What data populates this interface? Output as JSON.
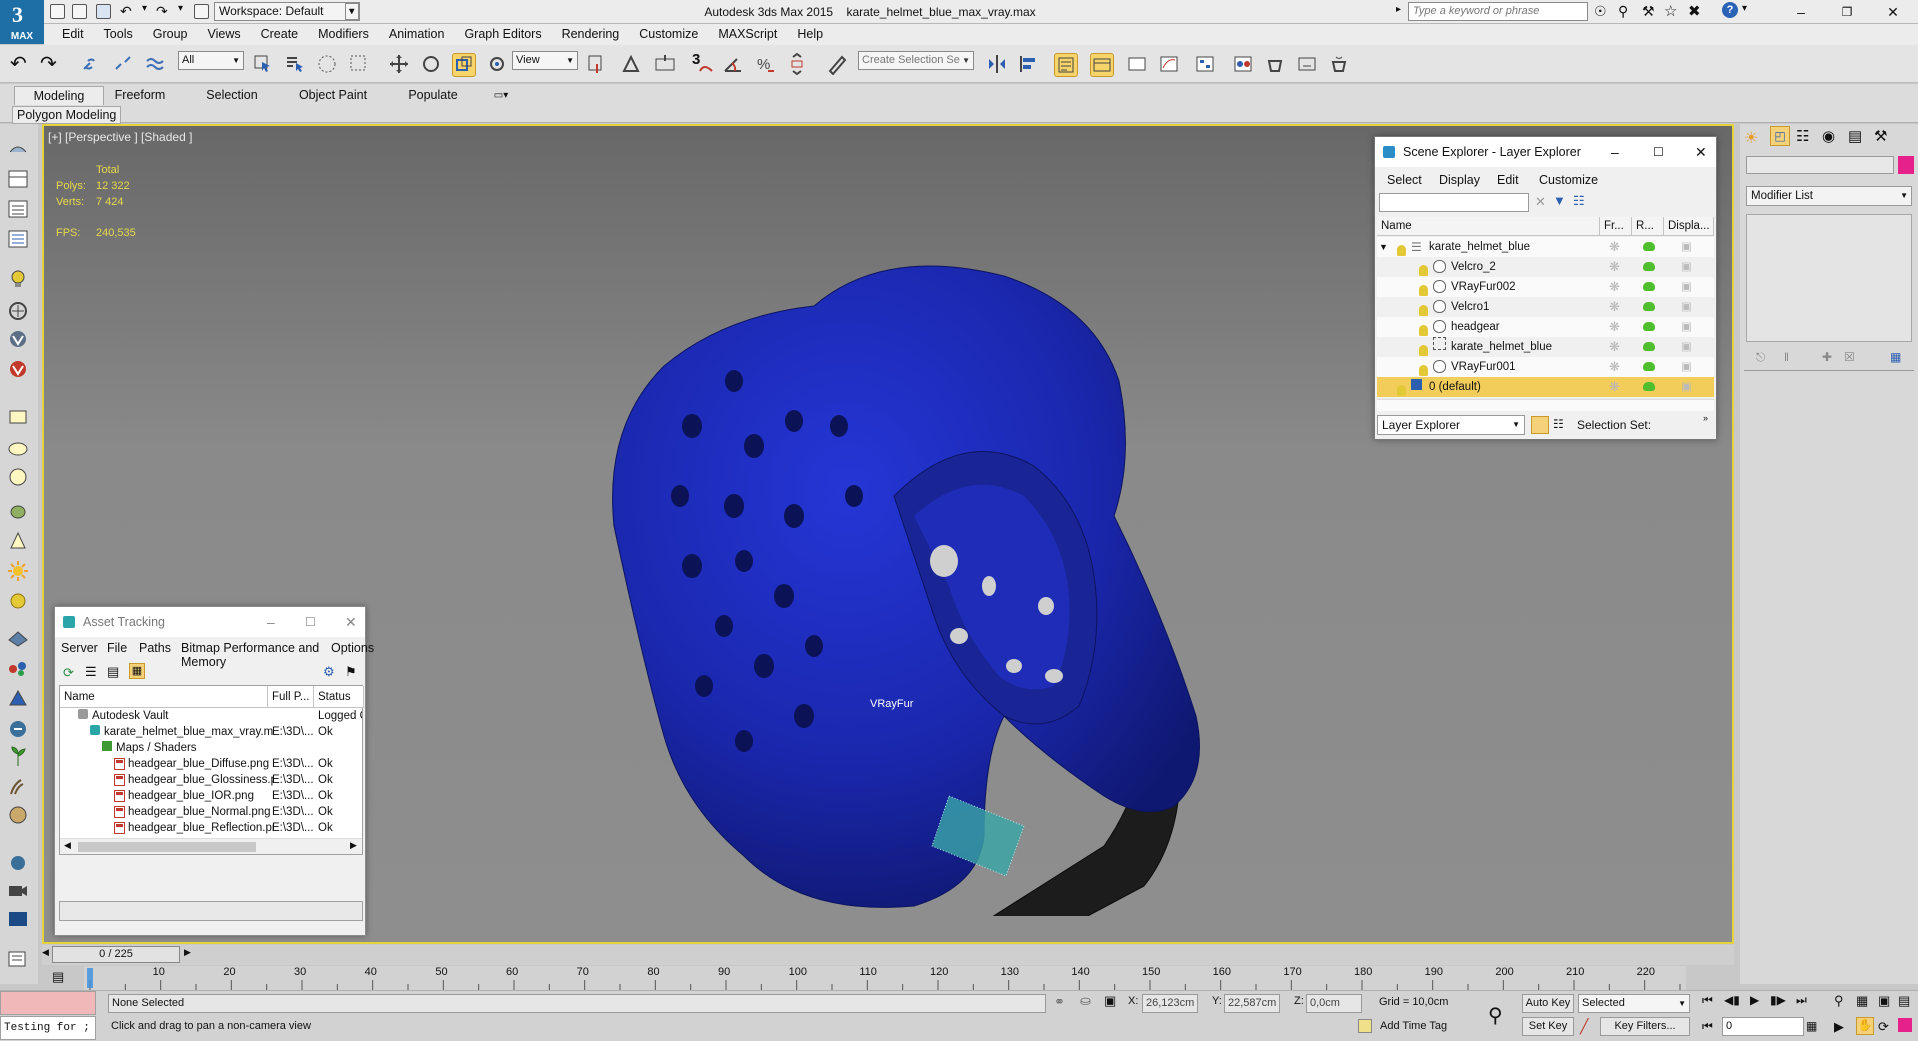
{
  "titlebar": {
    "workspace": "Workspace: Default",
    "app_name": "Autodesk 3ds Max  2015",
    "file_name": "karate_helmet_blue_max_vray.max",
    "search_placeholder": "Type a keyword or phrase",
    "logo_text": "MAX"
  },
  "menu": [
    "Edit",
    "Tools",
    "Group",
    "Views",
    "Create",
    "Modifiers",
    "Animation",
    "Graph Editors",
    "Rendering",
    "Customize",
    "MAXScript",
    "Help"
  ],
  "toolbar": {
    "selection_filter": "All",
    "ref_coord": "View",
    "create_selection_set": "Create Selection Se",
    "snap_angle_label": "3"
  },
  "ribbon": {
    "tabs": [
      "Modeling",
      "Freeform",
      "Selection",
      "Object Paint",
      "Populate"
    ],
    "sub_label": "Polygon Modeling"
  },
  "viewport": {
    "label": "[+] [Perspective ] [Shaded ]",
    "stats_header": "Total",
    "polys_label": "Polys:",
    "polys_value": "12 322",
    "verts_label": "Verts:",
    "verts_value": "7 424",
    "fps_label": "FPS:",
    "fps_value": "240,535",
    "object_tag": "VRayFur"
  },
  "scene_explorer": {
    "title": "Scene Explorer - Layer Explorer",
    "menu": [
      "Select",
      "Display",
      "Edit",
      "Customize"
    ],
    "columns": {
      "name": "Name",
      "frozen": "Fr...",
      "render": "R...",
      "display": "Displa..."
    },
    "rows": [
      {
        "name": "karate_helmet_blue",
        "kind": "layer",
        "level": 0
      },
      {
        "name": "Velcro_2",
        "kind": "object",
        "level": 1
      },
      {
        "name": "VRayFur002",
        "kind": "object",
        "level": 1
      },
      {
        "name": "Velcro1",
        "kind": "object",
        "level": 1
      },
      {
        "name": "headgear",
        "kind": "object",
        "level": 1
      },
      {
        "name": "karate_helmet_blue",
        "kind": "group",
        "level": 1
      },
      {
        "name": "VRayFur001",
        "kind": "object",
        "level": 1
      },
      {
        "name": "0 (default)",
        "kind": "layer-default",
        "level": 0
      }
    ],
    "footer_dropdown": "Layer Explorer",
    "selection_set_label": "Selection Set:"
  },
  "asset_tracking": {
    "title": "Asset Tracking",
    "menu": [
      "Server",
      "File",
      "Paths",
      "Bitmap Performance and Memory",
      "Options"
    ],
    "columns": {
      "name": "Name",
      "full_path": "Full P...",
      "status": "Status"
    },
    "rows": [
      {
        "name": "Autodesk Vault",
        "path": "",
        "status": "Logged Ou",
        "indent": 1,
        "icon": "vault"
      },
      {
        "name": "karate_helmet_blue_max_vray.max",
        "path": "E:\\3D\\...",
        "status": "Ok",
        "indent": 2,
        "icon": "max"
      },
      {
        "name": "Maps / Shaders",
        "path": "",
        "status": "",
        "indent": 3,
        "icon": "folder"
      },
      {
        "name": "headgear_blue_Diffuse.png",
        "path": "E:\\3D\\...",
        "status": "Ok",
        "indent": 4,
        "icon": "png"
      },
      {
        "name": "headgear_blue_Glossiness.png",
        "path": "E:\\3D\\...",
        "status": "Ok",
        "indent": 4,
        "icon": "png"
      },
      {
        "name": "headgear_blue_IOR.png",
        "path": "E:\\3D\\...",
        "status": "Ok",
        "indent": 4,
        "icon": "png"
      },
      {
        "name": "headgear_blue_Normal.png",
        "path": "E:\\3D\\...",
        "status": "Ok",
        "indent": 4,
        "icon": "png"
      },
      {
        "name": "headgear_blue_Reflection.png",
        "path": "E:\\3D\\...",
        "status": "Ok",
        "indent": 4,
        "icon": "png"
      }
    ]
  },
  "command_panel": {
    "modifier_list": "Modifier List"
  },
  "timeline": {
    "frame_display": "0 / 225",
    "ticks": [
      "0",
      "10",
      "20",
      "30",
      "40",
      "50",
      "60",
      "70",
      "80",
      "90",
      "100",
      "110",
      "120",
      "130",
      "140",
      "150",
      "160",
      "170",
      "180",
      "190",
      "200",
      "210",
      "220"
    ]
  },
  "status": {
    "script_listener": "Testing for ;",
    "selection": "None Selected",
    "prompt": "Click and drag to pan a non-camera view",
    "x_label": "X:",
    "x_value": "26,123cm",
    "y_label": "Y:",
    "y_value": "22,587cm",
    "z_label": "Z:",
    "z_value": "0,0cm",
    "grid": "Grid = 10,0cm",
    "add_time_tag": "Add Time Tag",
    "auto_key": "Auto Key",
    "set_key": "Set Key",
    "key_mode": "Selected",
    "key_filters": "Key Filters...",
    "current_frame": "0"
  },
  "colors": {
    "viewport_border": "#e6d23b",
    "stats_text": "#e8d94c",
    "helmet_blue": "#1b2bc7",
    "selected_row": "#f3cd5a"
  }
}
